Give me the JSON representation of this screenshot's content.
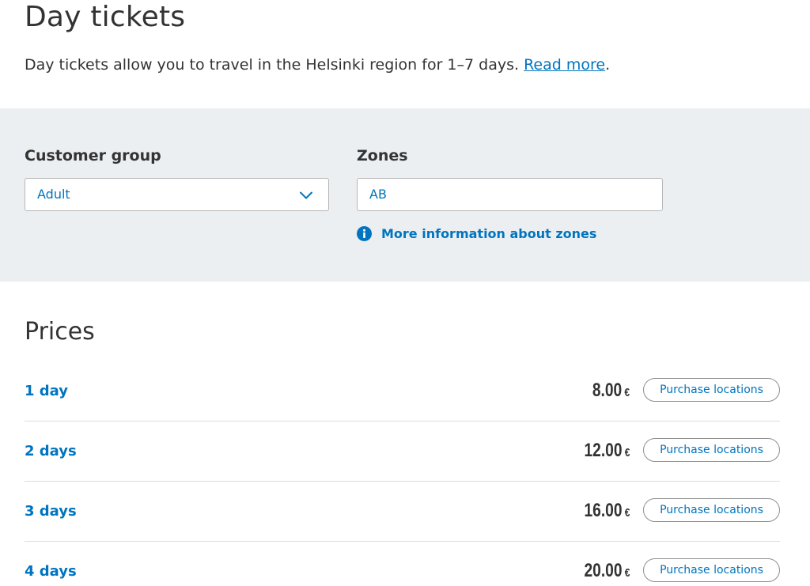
{
  "header": {
    "title": "Day tickets",
    "intro_text": "Day tickets allow you to travel in the Helsinki region for 1–7 days. ",
    "read_more": "Read more",
    "intro_end": "."
  },
  "filters": {
    "customer_group_label": "Customer group",
    "customer_group_value": "Adult",
    "zones_label": "Zones",
    "zones_value": "AB",
    "zones_info_link": "More information about zones"
  },
  "prices": {
    "title": "Prices",
    "rows": [
      {
        "duration": "1 day",
        "amount": "8.00",
        "currency": "€",
        "button": "Purchase locations"
      },
      {
        "duration": "2 days",
        "amount": "12.00",
        "currency": "€",
        "button": "Purchase locations"
      },
      {
        "duration": "3 days",
        "amount": "16.00",
        "currency": "€",
        "button": "Purchase locations"
      },
      {
        "duration": "4 days",
        "amount": "20.00",
        "currency": "€",
        "button": "Purchase locations"
      }
    ]
  },
  "colors": {
    "accent": "#0074bf",
    "panel_background": "#eceff2",
    "text": "#333333"
  },
  "icons": {
    "dropdown": "chevron-down-icon",
    "info": "info-icon"
  }
}
